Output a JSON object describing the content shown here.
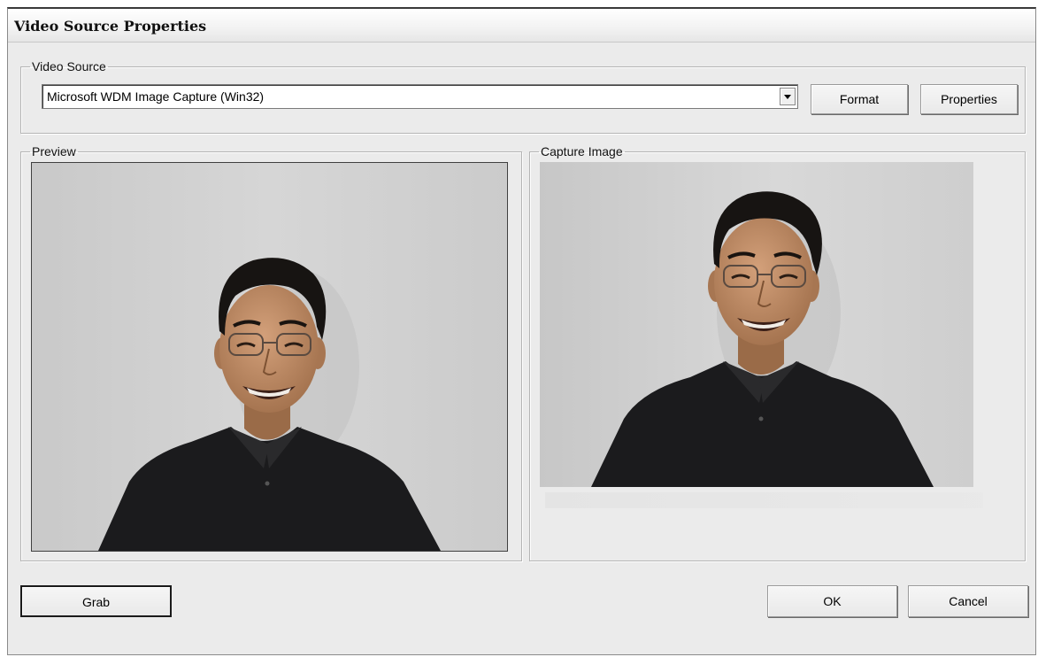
{
  "window": {
    "title": "Video Source Properties"
  },
  "video_source": {
    "legend": "Video Source",
    "selected": "Microsoft WDM Image Capture (Win32)",
    "format_button": "Format",
    "properties_button": "Properties"
  },
  "preview": {
    "legend": "Preview",
    "image_icon": "webcam-live-preview"
  },
  "capture": {
    "legend": "Capture Image",
    "image_icon": "captured-still-image"
  },
  "buttons": {
    "grab": "Grab",
    "ok": "OK",
    "cancel": "Cancel"
  },
  "colors": {
    "dialog_bg": "#ebebeb",
    "photo_wall": "#d0d0d0",
    "shirt": "#1b1b1d",
    "skin": "#b9875f",
    "hair": "#171412"
  }
}
